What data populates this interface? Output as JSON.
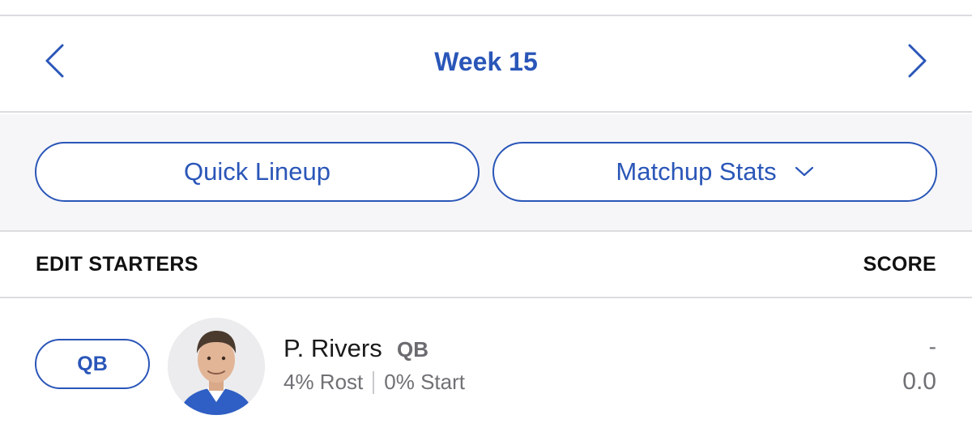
{
  "week_nav": {
    "prev_icon": "chevron-left-icon",
    "title": "Week 15",
    "next_icon": "chevron-right-icon"
  },
  "actions": {
    "quick_lineup_label": "Quick Lineup",
    "matchup_stats_label": "Matchup Stats",
    "matchup_icon": "chevron-down-icon"
  },
  "section": {
    "left_header": "EDIT STARTERS",
    "right_header": "SCORE"
  },
  "players": [
    {
      "slot": "QB",
      "name": "P. Rivers",
      "position": "QB",
      "rost": "4% Rost",
      "start": "0% Start",
      "projection": "-",
      "score": "0.0"
    }
  ],
  "colors": {
    "accent": "#2a56b8",
    "muted_text": "#707075",
    "bar_background": "#f6f6f8",
    "divider": "#dcdce0"
  }
}
